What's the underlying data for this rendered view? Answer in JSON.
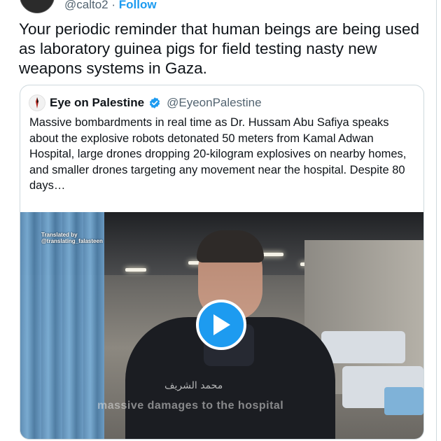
{
  "tweet": {
    "handle_fragment": "@calto2",
    "separator": "·",
    "follow_label": "Follow",
    "text": "Your periodic reminder that human beings are being used as laboratory guinea pigs for field testing nasty new weapons systems in Gaza."
  },
  "quote": {
    "name": "Eye on Palestine",
    "handle": "@EyeonPalestine",
    "verified_icon": "verified-badge-icon",
    "avatar_icon": "flag-avatar-icon",
    "text": "Massive bombardments in real time as Dr. Hussam Abu Safiya speaks about the explosive robots detonated 50 meters from Kamal Adwan Hospital, large drones dropping 20-kilogram explosives on nearby homes, and smaller drones targeting any movement near the hospital. Despite 80 days…",
    "media": {
      "watermark_line1": "Translated by",
      "watermark_line2": "@translating_falasteen",
      "subtitle_arabic": "محمد الشريف",
      "subtitle_english": "massive damages to the hospital",
      "play_icon": "play-icon"
    }
  },
  "colors": {
    "accent": "#1d9bf0",
    "text": "#0f1419",
    "muted": "#536471",
    "border": "#cfd9de"
  }
}
